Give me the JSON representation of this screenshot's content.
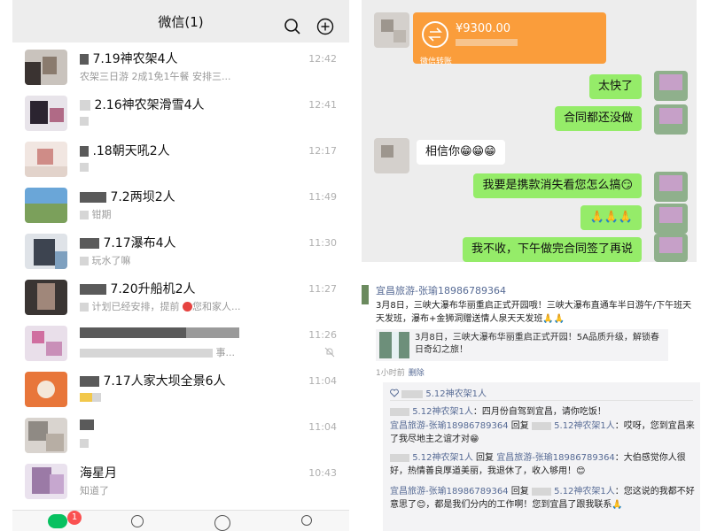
{
  "chat_list": {
    "title": "微信(1)",
    "header_icons": [
      "search-icon",
      "add-circle-icon"
    ],
    "items": [
      {
        "name": "7.19神农架4人",
        "preview": "农架三日游 2成1免1午餐 安排三...",
        "time": "12:42"
      },
      {
        "name": "2.16神农架滑雪4人",
        "preview": "",
        "time": "12:41"
      },
      {
        "name": ".18朝天吼2人",
        "preview": "",
        "time": "12:17"
      },
      {
        "name": "7.2两坝2人",
        "preview": "钳期",
        "time": "11:49"
      },
      {
        "name": "7.17瀑布4人",
        "preview": "玩水了嘛",
        "time": "11:30"
      },
      {
        "name": "7.20升船机2人",
        "preview": "计划已经安排，提前",
        "preview_tail": "您和家人...",
        "time": "11:27"
      },
      {
        "name": "",
        "preview": "事...",
        "time": "11:26",
        "muted": true
      },
      {
        "name": "7.17人家大坝全景6人",
        "preview": "",
        "time": "11:04"
      },
      {
        "name": "",
        "preview": "",
        "time": "11:04"
      },
      {
        "name": "海星月",
        "preview": "知道了",
        "time": "10:43"
      }
    ],
    "tab_badge": "1"
  },
  "chat_window": {
    "transfer_amount": "¥9300.00",
    "transfer_label": "微信转账",
    "messages": [
      {
        "side": "right",
        "text": "太快了"
      },
      {
        "side": "right",
        "text": "合同都还没做"
      },
      {
        "side": "left",
        "text": "相信你😁😁😁"
      },
      {
        "side": "right",
        "text": "我要是携款消失看您怎么搞😏"
      },
      {
        "side": "right",
        "text": "🙏🙏🙏"
      },
      {
        "side": "right",
        "text": "我不收，下午做完合同签了再说"
      }
    ]
  },
  "moment": {
    "author": "宜昌旅游-张瑜18986789364",
    "text": "3月8日，三峡大瀑布华丽重启正式开园哦！三峡大瀑布直通车半日游午/下午班天天发班，瀑布+金狮洞赠送情人泉天天发班🙏🙏",
    "link_text": "3月8日，三峡大瀑布华丽重启正式开园！5A品质升级，解锁春日奇幻之旅！",
    "time": "1小时前",
    "delete_label": "删除",
    "likes": "5.12神农架1人",
    "comments": [
      {
        "user": "5.12神农架1人",
        "reply_to": "",
        "text": "四月份自驾到宜昌，请你吃饭！"
      },
      {
        "user": "宜昌旅游-张瑜18986789364",
        "reply_to": "5.12神农架1人",
        "text": "哎呀，您到宜昌来了我尽地主之谊才对😁"
      },
      {
        "user": "5.12神农架1人",
        "reply_to": "宜昌旅游-张瑜18986789364",
        "text": "大伯感觉你人很好，热情善良厚道美丽，我退休了，收入够用！😊"
      },
      {
        "user": "宜昌旅游-张瑜18986789364",
        "reply_to": "5.12神农架1人",
        "text": "您这说的我都不好意思了😊，都是我们分内的工作啊！您到宜昌了跟我联系🙏"
      }
    ],
    "reply_word": "回复"
  }
}
